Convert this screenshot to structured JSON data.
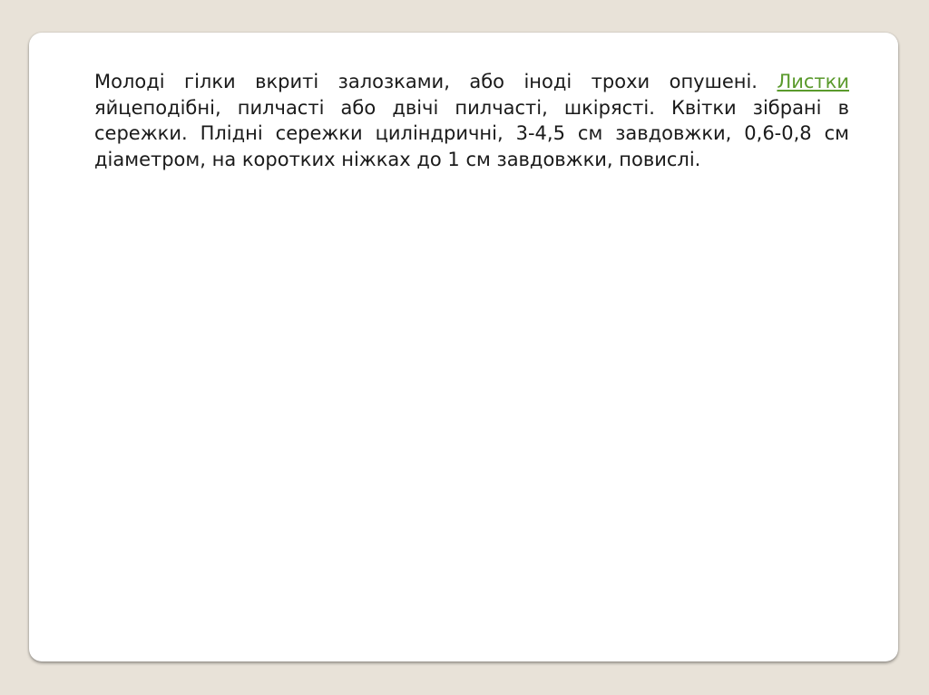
{
  "slide": {
    "text_before_link": "Молоді гілки вкриті залозками, або іноді трохи опушені. ",
    "link_text": "Листки",
    "text_after_link": " яйцеподібні, пилчасті або двічі пилчасті, шкірясті. Квітки зібрані в сережки. Плідні сережки циліндричні, 3-4,5 см завдовжки, 0,6-0,8 см діаметром, на коротких ніжках до 1 см завдовжки, повислі."
  },
  "colors": {
    "background": "#e8e2d8",
    "card": "#ffffff",
    "text": "#1a1a1a",
    "link": "#5a9a2c"
  }
}
